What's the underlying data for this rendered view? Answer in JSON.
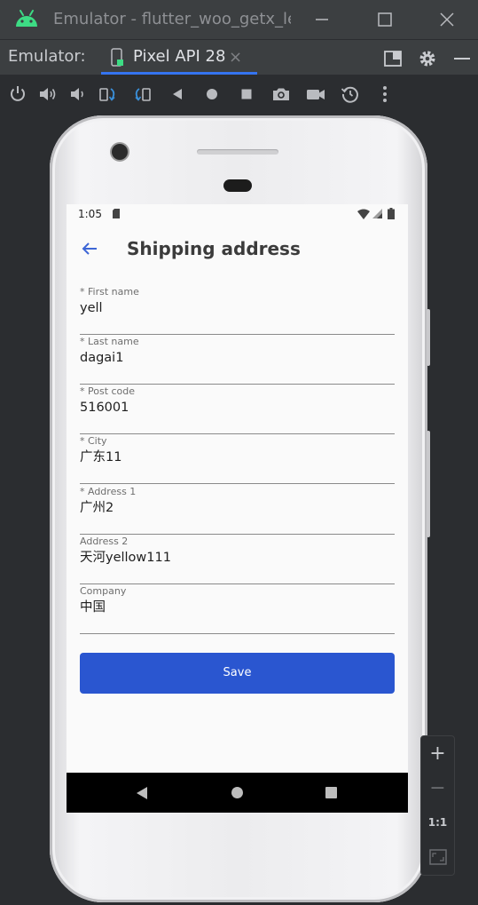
{
  "window": {
    "title": "Emulator - flutter_woo_getx_le",
    "buttons": [
      "minimize-icon",
      "maximize-icon",
      "close-icon"
    ]
  },
  "tabbar": {
    "prefix": "Emulator:",
    "device_tab": {
      "label": "Pixel API 28",
      "close": "×",
      "icon": "phone-device-icon"
    },
    "actions": [
      "layout-panel-icon",
      "gear-icon",
      "minus-icon"
    ]
  },
  "toolbar": {
    "tools": [
      "power-icon",
      "volume-up-icon",
      "volume-down-icon",
      "rotate-left-icon",
      "rotate-right-icon",
      "back-triangle-icon",
      "home-circle-icon",
      "overview-square-icon",
      "camera-icon",
      "video-camera-icon",
      "snapshot-restore-icon",
      "more-vertical-icon"
    ]
  },
  "device": {
    "status_bar": {
      "time": "1:05"
    },
    "app_bar": {
      "title": "Shipping address"
    },
    "form": {
      "fields": [
        {
          "label": "* First name",
          "value": "yell"
        },
        {
          "label": "* Last name",
          "value": "dagai1"
        },
        {
          "label": "* Post code",
          "value": "516001"
        },
        {
          "label": "* City",
          "value": "广东11"
        },
        {
          "label": "* Address 1",
          "value": "广州2"
        },
        {
          "label": "Address 2",
          "value": "天河yellow111"
        },
        {
          "label": "Company",
          "value": "中国"
        }
      ],
      "save_label": "Save"
    },
    "nav_bar": [
      "nav-back-icon",
      "nav-home-icon",
      "nav-recent-icon"
    ]
  },
  "zoom": {
    "plus": "+",
    "minus": "−",
    "one_to_one": "1:1",
    "fit_icon": "fit-screen-icon"
  },
  "colors": {
    "accent": "#3574f0",
    "save_button": "#2a56d0",
    "android_green": "#3ddc84",
    "back_arrow": "#3d66d6"
  }
}
